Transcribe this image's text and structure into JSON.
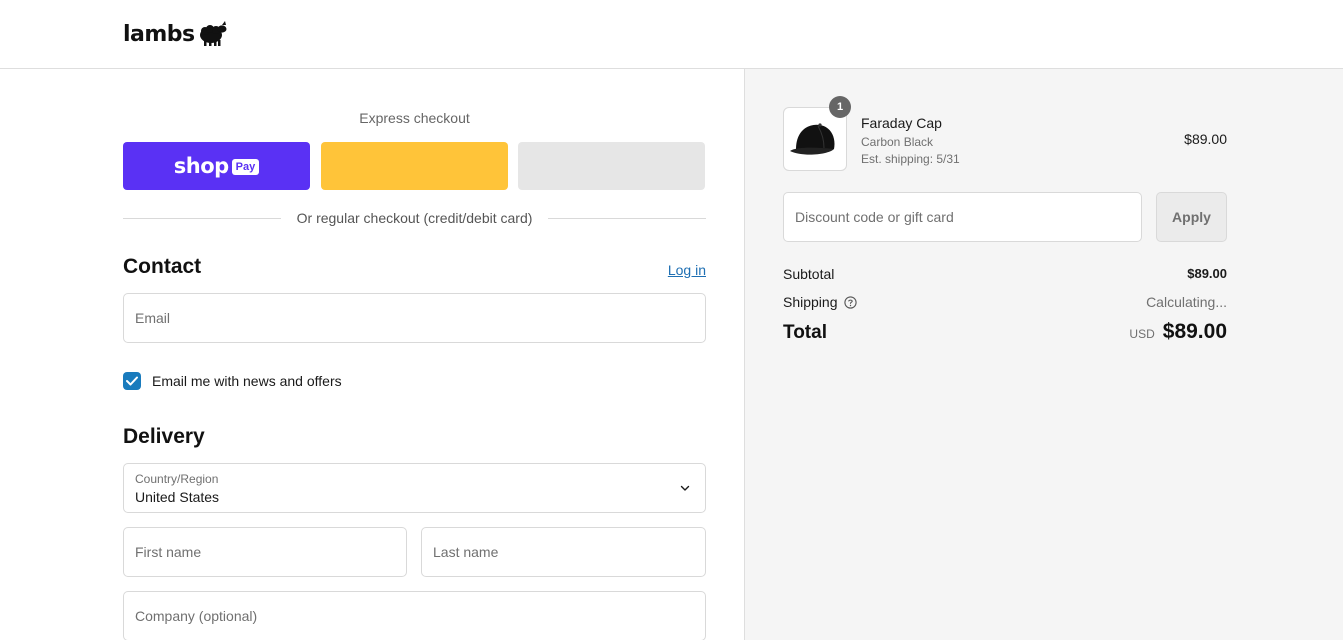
{
  "brand": {
    "name": "Lambs"
  },
  "express": {
    "title": "Express checkout",
    "shop_word": "shop",
    "shop_pay": "Pay",
    "divider_text": "Or regular checkout (credit/debit card)"
  },
  "contact": {
    "title": "Contact",
    "login_label": "Log in",
    "email_placeholder": "Email",
    "newsletter_label": "Email me with news and offers",
    "newsletter_checked": true
  },
  "delivery": {
    "title": "Delivery",
    "country_label": "Country/Region",
    "country_value": "United States",
    "first_name_placeholder": "First name",
    "last_name_placeholder": "Last name",
    "company_placeholder": "Company (optional)"
  },
  "summary": {
    "item": {
      "quantity": "1",
      "name": "Faraday Cap",
      "variant": "Carbon Black",
      "shipping_estimate": "Est. shipping: 5/31",
      "price": "$89.00"
    },
    "discount_placeholder": "Discount code or gift card",
    "apply_label": "Apply",
    "subtotal_label": "Subtotal",
    "subtotal_value": "$89.00",
    "shipping_label": "Shipping",
    "shipping_value": "Calculating...",
    "total_label": "Total",
    "total_currency": "USD",
    "total_value": "$89.00"
  },
  "colors": {
    "shop_pay": "#5a31f4",
    "paypal": "#ffc439",
    "link": "#1e6fb3",
    "checkbox": "#197bbd"
  }
}
